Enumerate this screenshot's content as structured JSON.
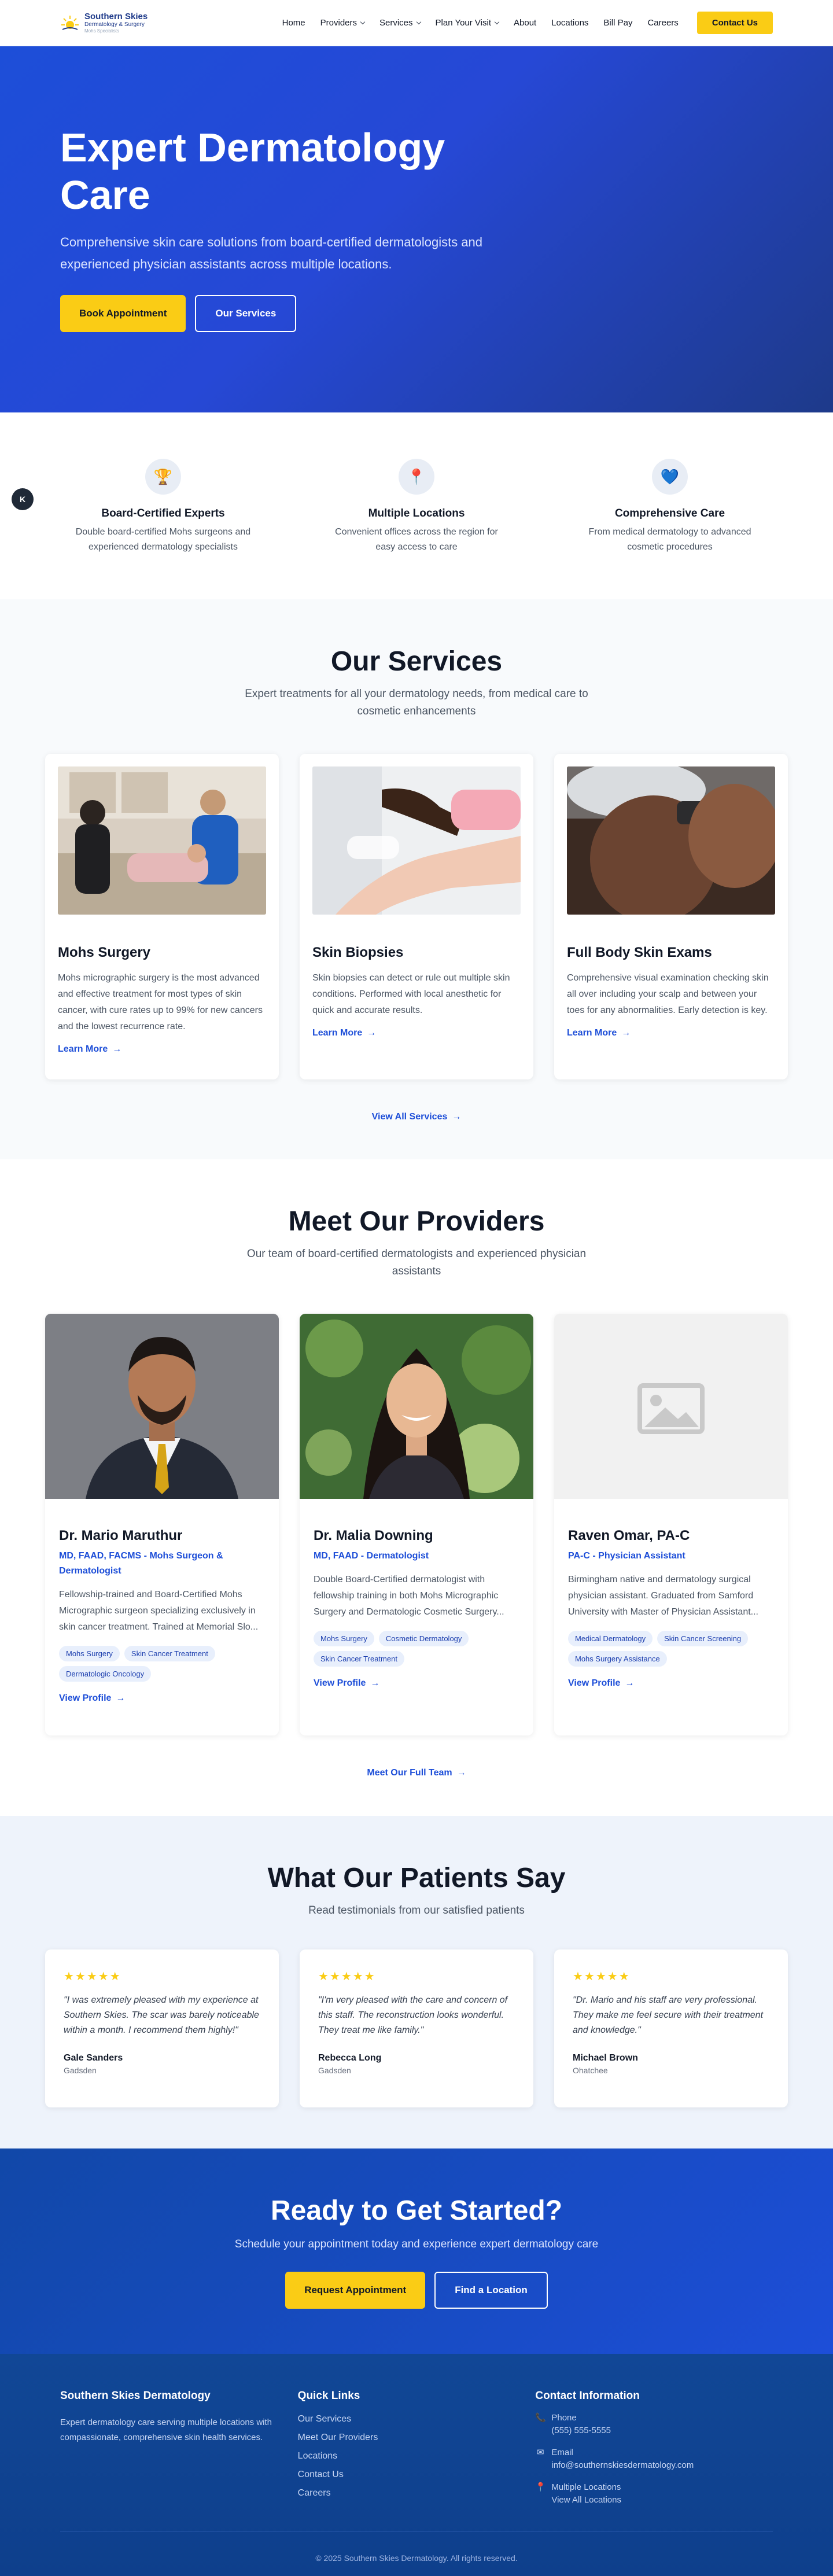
{
  "header": {
    "logo": {
      "line1": "Southern Skies",
      "line2": "Dermatology & Surgery",
      "line3": "Mohs Specialists"
    },
    "nav": [
      {
        "label": "Home",
        "dropdown": false
      },
      {
        "label": "Providers",
        "dropdown": true
      },
      {
        "label": "Services",
        "dropdown": true
      },
      {
        "label": "Plan Your Visit",
        "dropdown": true
      },
      {
        "label": "About",
        "dropdown": false
      },
      {
        "label": "Locations",
        "dropdown": false
      },
      {
        "label": "Bill Pay",
        "dropdown": false
      },
      {
        "label": "Careers",
        "dropdown": false
      }
    ],
    "contact_label": "Contact Us"
  },
  "hero": {
    "title": "Expert Dermatology Care",
    "subtitle": "Comprehensive skin care solutions from board-certified dermatologists and experienced physician assistants across multiple locations.",
    "primary_label": "Book Appointment",
    "secondary_label": "Our Services"
  },
  "features": {
    "float_button": "K",
    "items": [
      {
        "icon": "trophy-icon",
        "glyph": "🏆",
        "title": "Board-Certified Experts",
        "text": "Double board-certified Mohs surgeons and experienced dermatology specialists"
      },
      {
        "icon": "location-pin-icon",
        "glyph": "📍",
        "title": "Multiple Locations",
        "text": "Convenient offices across the region for easy access to care"
      },
      {
        "icon": "heart-icon",
        "glyph": "💙",
        "title": "Comprehensive Care",
        "text": "From medical dermatology to advanced cosmetic procedures"
      }
    ]
  },
  "services": {
    "title": "Our Services",
    "subtitle": "Expert treatments for all your dermatology needs, from medical care to cosmetic enhancements",
    "items": [
      {
        "title": "Mohs Surgery",
        "text": "Mohs micrographic surgery is the most advanced and effective treatment for most types of skin cancer, with cure rates up to 99% for new cancers and the lowest recurrence rate.",
        "link": "Learn More"
      },
      {
        "title": "Skin Biopsies",
        "text": "Skin biopsies can detect or rule out multiple skin conditions. Performed with local anesthetic for quick and accurate results.",
        "link": "Learn More"
      },
      {
        "title": "Full Body Skin Exams",
        "text": "Comprehensive visual examination checking skin all over including your scalp and between your toes for any abnormalities. Early detection is key.",
        "link": "Learn More"
      }
    ],
    "view_all": "View All Services"
  },
  "providers": {
    "title": "Meet Our Providers",
    "subtitle": "Our team of board-certified dermatologists and experienced physician assistants",
    "items": [
      {
        "name": "Dr. Mario Maruthur",
        "credentials": "MD, FAAD, FACMS - Mohs Surgeon & Dermatologist",
        "bio": "Fellowship-trained and Board-Certified Mohs Micrographic surgeon specializing exclusively in skin cancer treatment. Trained at Memorial Slo...",
        "tags": [
          "Mohs Surgery",
          "Skin Cancer Treatment",
          "Dermatologic Oncology"
        ],
        "link": "View Profile"
      },
      {
        "name": "Dr. Malia Downing",
        "credentials": "MD, FAAD - Dermatologist",
        "bio": "Double Board-Certified dermatologist with fellowship training in both Mohs Micrographic Surgery and Dermatologic Cosmetic Surgery...",
        "tags": [
          "Mohs Surgery",
          "Cosmetic Dermatology",
          "Skin Cancer Treatment"
        ],
        "link": "View Profile"
      },
      {
        "name": "Raven Omar, PA-C",
        "credentials": "PA-C - Physician Assistant",
        "bio": "Birmingham native and dermatology surgical physician assistant. Graduated from Samford University with Master of Physician Assistant...",
        "tags": [
          "Medical Dermatology",
          "Skin Cancer Screening",
          "Mohs Surgery Assistance"
        ],
        "link": "View Profile"
      }
    ],
    "full_team": "Meet Our Full Team"
  },
  "testimonials": {
    "title": "What Our Patients Say",
    "subtitle": "Read testimonials from our satisfied patients",
    "items": [
      {
        "stars": "★★★★★",
        "quote": "\"I was extremely pleased with my experience at Southern Skies. The scar was barely noticeable within a month. I recommend them highly!\"",
        "name": "Gale Sanders",
        "location": "Gadsden"
      },
      {
        "stars": "★★★★★",
        "quote": "\"I'm very pleased with the care and concern of this staff. The reconstruction looks wonderful. They treat me like family.\"",
        "name": "Rebecca Long",
        "location": "Gadsden"
      },
      {
        "stars": "★★★★★",
        "quote": "\"Dr. Mario and his staff are very professional. They make me feel secure with their treatment and knowledge.\"",
        "name": "Michael Brown",
        "location": "Ohatchee"
      }
    ]
  },
  "cta": {
    "title": "Ready to Get Started?",
    "subtitle": "Schedule your appointment today and experience expert dermatology care",
    "primary_label": "Request Appointment",
    "secondary_label": "Find a Location"
  },
  "footer": {
    "about_title": "Southern Skies Dermatology",
    "about_text": "Expert dermatology care serving multiple locations with compassionate, comprehensive skin health services.",
    "links_title": "Quick Links",
    "links": [
      "Our Services",
      "Meet Our Providers",
      "Locations",
      "Contact Us",
      "Careers"
    ],
    "contact_title": "Contact Information",
    "phone_label": "Phone",
    "phone": "(555) 555-5555",
    "email_label": "Email",
    "email": "info@southernskiesdermatology.com",
    "locations_label": "Multiple Locations",
    "locations_link": "View All Locations",
    "copyright": "© 2025 Southern Skies Dermatology. All rights reserved."
  },
  "colors": {
    "brand_blue": "#1d4ed8",
    "accent_yellow": "#facc15",
    "footer_blue": "#0e3f8c"
  }
}
